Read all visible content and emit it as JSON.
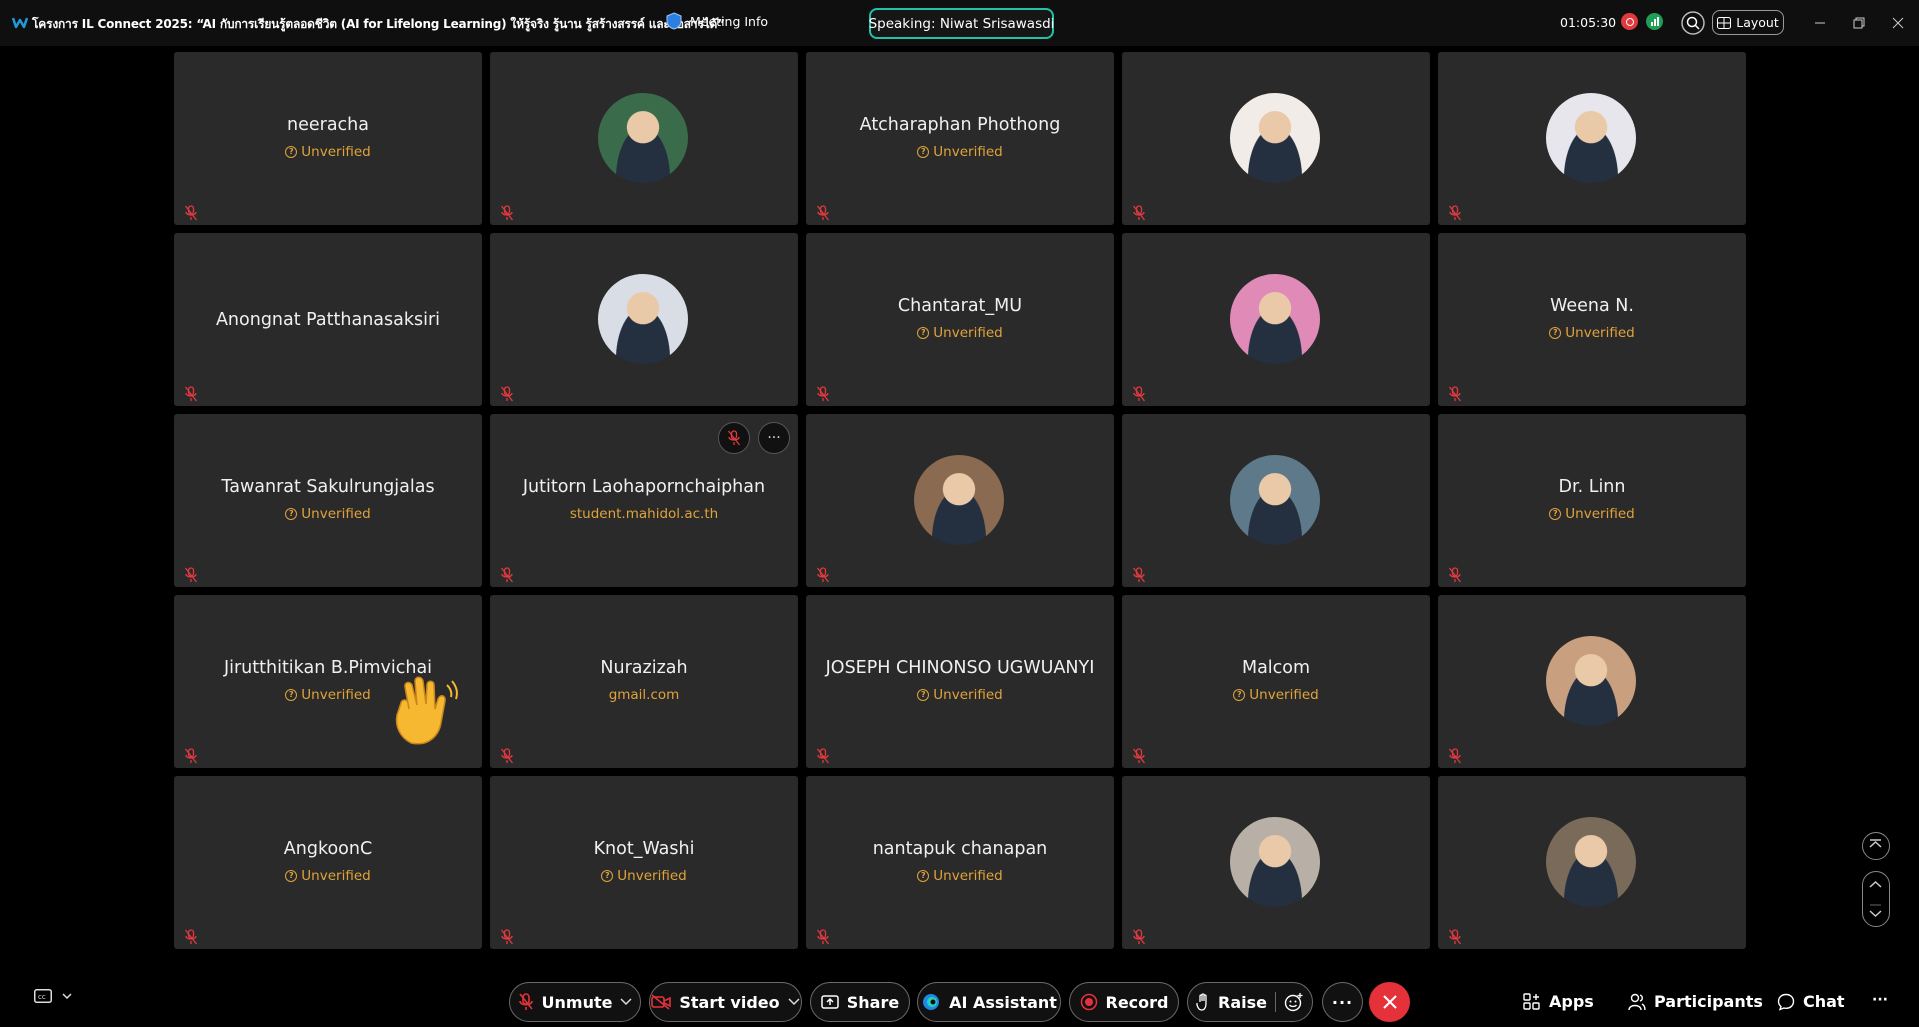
{
  "topbar": {
    "title": "โครงการ IL Connect 2025: “AI กับการเรียนรู้ตลอดชีวิต (AI for Lifelong Learning) ให้รู้จริง รู้นาน รู้สร้างสรรค์ และสื่อสารได้”",
    "meeting_info": "Meeting Info",
    "speaking": "Speaking: Niwat Srisawasdi",
    "timer": "01:05:30",
    "layout": "Layout"
  },
  "tiles": [
    {
      "name": "neeracha",
      "sub": "Unverified",
      "avatar": false
    },
    {
      "name": "",
      "sub": "",
      "avatar": true,
      "avatar_color": "#3a6b4a"
    },
    {
      "name": "Atcharaphan Phothong",
      "sub": "Unverified",
      "avatar": false
    },
    {
      "name": "",
      "sub": "",
      "avatar": true,
      "avatar_color": "#f2ece8"
    },
    {
      "name": "",
      "sub": "",
      "avatar": true,
      "avatar_color": "#e6e6ec"
    },
    {
      "name": "Anongnat Patthanasaksiri",
      "sub": "",
      "avatar": false
    },
    {
      "name": "",
      "sub": "",
      "avatar": true,
      "avatar_color": "#d8dde6"
    },
    {
      "name": "Chantarat_MU",
      "sub": "Unverified",
      "avatar": false
    },
    {
      "name": "",
      "sub": "",
      "avatar": true,
      "avatar_color": "#e08ab8"
    },
    {
      "name": "Weena N.",
      "sub": "Unverified",
      "avatar": false
    },
    {
      "name": "Tawanrat Sakulrungjalas",
      "sub": "Unverified",
      "avatar": false
    },
    {
      "name": "Jutitorn Laohapornchaiphan",
      "sub": "student.mahidol.ac.th",
      "avatar": false,
      "hover": true
    },
    {
      "name": "",
      "sub": "",
      "avatar": true,
      "avatar_color": "#8a6a50"
    },
    {
      "name": "",
      "sub": "",
      "avatar": true,
      "avatar_color": "#5e7a8a"
    },
    {
      "name": "Dr. Linn",
      "sub": "Unverified",
      "avatar": false
    },
    {
      "name": "Jirutthitikan B.Pimvichai",
      "sub": "Unverified",
      "avatar": false,
      "wave": true
    },
    {
      "name": "Nurazizah",
      "sub": "gmail.com",
      "avatar": false
    },
    {
      "name": "JOSEPH CHINONSO UGWUANYI",
      "sub": "Unverified",
      "avatar": false
    },
    {
      "name": "Malcom",
      "sub": "Unverified",
      "avatar": false
    },
    {
      "name": "",
      "sub": "",
      "avatar": true,
      "avatar_color": "#c8a080"
    },
    {
      "name": "AngkoonC",
      "sub": "Unverified",
      "avatar": false
    },
    {
      "name": "Knot_Washi",
      "sub": "Unverified",
      "avatar": false
    },
    {
      "name": "nantapuk chanapan",
      "sub": "Unverified",
      "avatar": false
    },
    {
      "name": "",
      "sub": "",
      "avatar": true,
      "avatar_color": "#b8b0a6"
    },
    {
      "name": "",
      "sub": "",
      "avatar": true,
      "avatar_color": "#7a6a5a"
    }
  ],
  "controls": {
    "unmute": "Unmute",
    "start_video": "Start video",
    "share": "Share",
    "ai_assistant": "AI Assistant",
    "record": "Record",
    "raise": "Raise",
    "apps": "Apps",
    "participants": "Participants",
    "chat": "Chat"
  },
  "colors": {
    "accent_teal": "#22c2a8",
    "unverified": "#e0a33a",
    "leave_red": "#e5323a",
    "tile_bg": "#2a2a2a"
  }
}
